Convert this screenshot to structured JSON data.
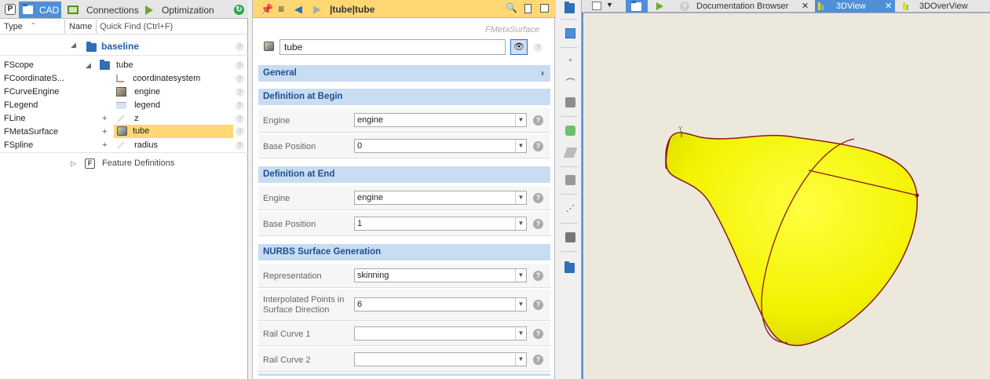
{
  "left": {
    "tabs": [
      {
        "label": "CAD"
      },
      {
        "label": "Connections"
      },
      {
        "label": "Optimization"
      }
    ],
    "p_button": "P",
    "headers": {
      "type": "Type",
      "name": "Name",
      "quick_find": "Quick Find (Ctrl+F)"
    },
    "types": [
      "FScope",
      "FCoordinateS...",
      "FCurveEngine",
      "FLegend",
      "FLine",
      "FMetaSurface",
      "FSpline"
    ],
    "type_plus": [
      "+",
      "+",
      "+"
    ],
    "tree": {
      "root": "baseline",
      "scope": "tube",
      "children": [
        "coordinatesystem",
        "engine",
        "legend",
        "z",
        "tube",
        "radius"
      ],
      "feature_definitions": "Feature Definitions",
      "feature_badge": "F"
    },
    "help": "?"
  },
  "middle": {
    "title": "|tube|tube",
    "class_name": "FMetaSurface",
    "name_value": "tube",
    "sections": {
      "general": "General",
      "begin": "Definition at Begin",
      "end": "Definition at End",
      "nurbs": "NURBS Surface Generation"
    },
    "fields": {
      "begin_engine_label": "Engine",
      "begin_engine_value": "engine",
      "begin_base_label": "Base Position",
      "begin_base_value": "0",
      "end_engine_label": "Engine",
      "end_engine_value": "engine",
      "end_base_label": "Base Position",
      "end_base_value": "1",
      "representation_label": "Representation",
      "representation_value": "skinning",
      "interp_label_line1": "Interpolated Points in",
      "interp_label_line2": "Surface Direction",
      "interp_value": "6",
      "rail1_label": "Rail Curve 1",
      "rail1_value": "",
      "rail2_label": "Rail Curve 2",
      "rail2_value": ""
    },
    "help": "?"
  },
  "right": {
    "tabs": [
      {
        "label": "Documentation Browser"
      },
      {
        "label": "3DView"
      },
      {
        "label": "3DOverView"
      }
    ],
    "close": "✕",
    "axis_label": "Y"
  },
  "colors": {
    "accent": "#4e8fd8",
    "selection": "#ffd873",
    "section": "#c8dcf2",
    "surface": "#ffff00",
    "edge": "#8b1a1a"
  }
}
